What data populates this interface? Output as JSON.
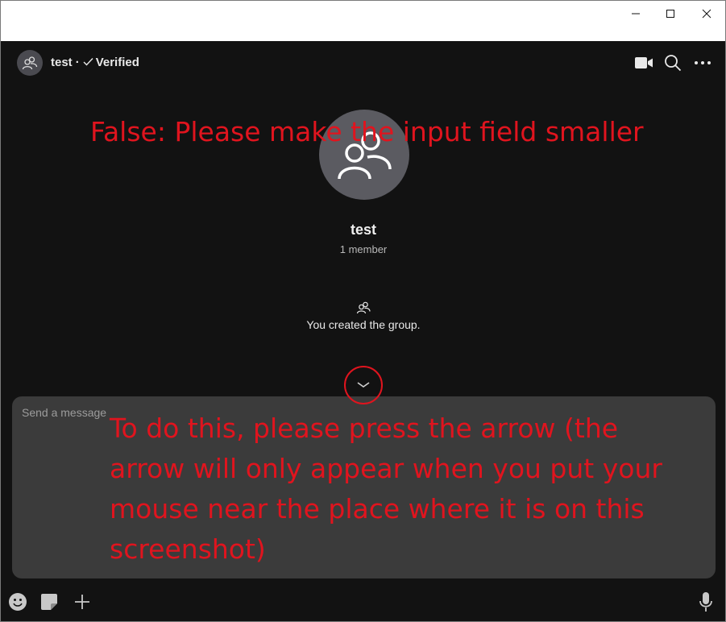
{
  "window": {
    "controls": [
      "minimize",
      "maximize",
      "close"
    ]
  },
  "header": {
    "title": "test",
    "separator": "·",
    "verified_label": "Verified",
    "icons": [
      "group-avatar-icon",
      "video-call-icon",
      "search-icon",
      "more-options-icon"
    ]
  },
  "conversation": {
    "group_name": "test",
    "member_count": "1 member",
    "event_text": "You created the group."
  },
  "composer": {
    "placeholder": "Send a message",
    "value": ""
  },
  "toolbar": {
    "icons": [
      "emoji-icon",
      "sticker-icon",
      "attach-add-icon",
      "microphone-icon"
    ]
  },
  "annotations": {
    "top": "False: Please make the input field smaller",
    "bottom": "To do this, please press the arrow (the arrow will only appear when you put your mouse near the place where it is on this screenshot)"
  },
  "colors": {
    "background": "#121212",
    "composer": "#3b3b3b",
    "annotation": "#e0141e",
    "avatar": "#5b5b61"
  }
}
